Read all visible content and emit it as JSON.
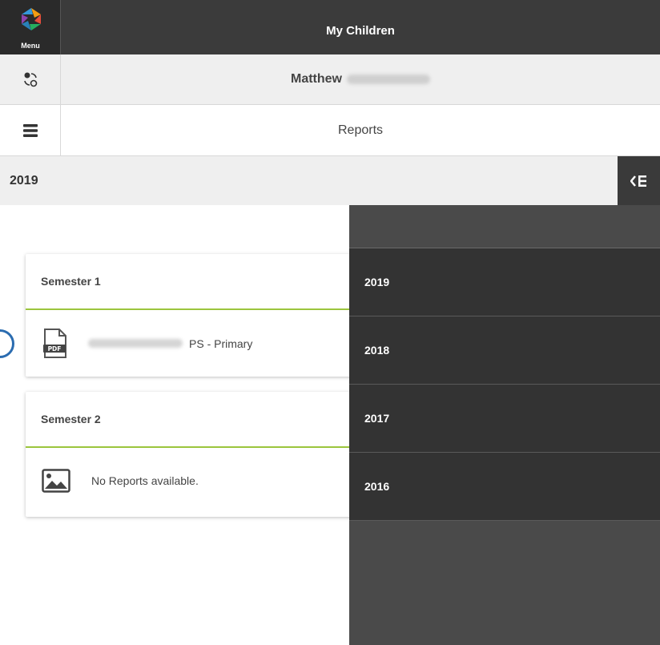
{
  "header": {
    "menu_label": "Menu",
    "title": "My Children"
  },
  "student": {
    "first_name": "Matthew"
  },
  "section": {
    "title": "Reports"
  },
  "year_bar": {
    "selected_year": "2019"
  },
  "semesters": [
    {
      "title": "Semester 1",
      "report_suffix": "PS - Primary",
      "icon": "pdf-file-icon"
    },
    {
      "title": "Semester 2",
      "message": "No Reports available.",
      "icon": "image-placeholder-icon"
    }
  ],
  "year_drawer": {
    "years": [
      "2019",
      "2018",
      "2017",
      "2016"
    ]
  },
  "colors": {
    "accent": "#9bc53d",
    "topbar": "#3b3b3b",
    "drawer": "#333333"
  }
}
